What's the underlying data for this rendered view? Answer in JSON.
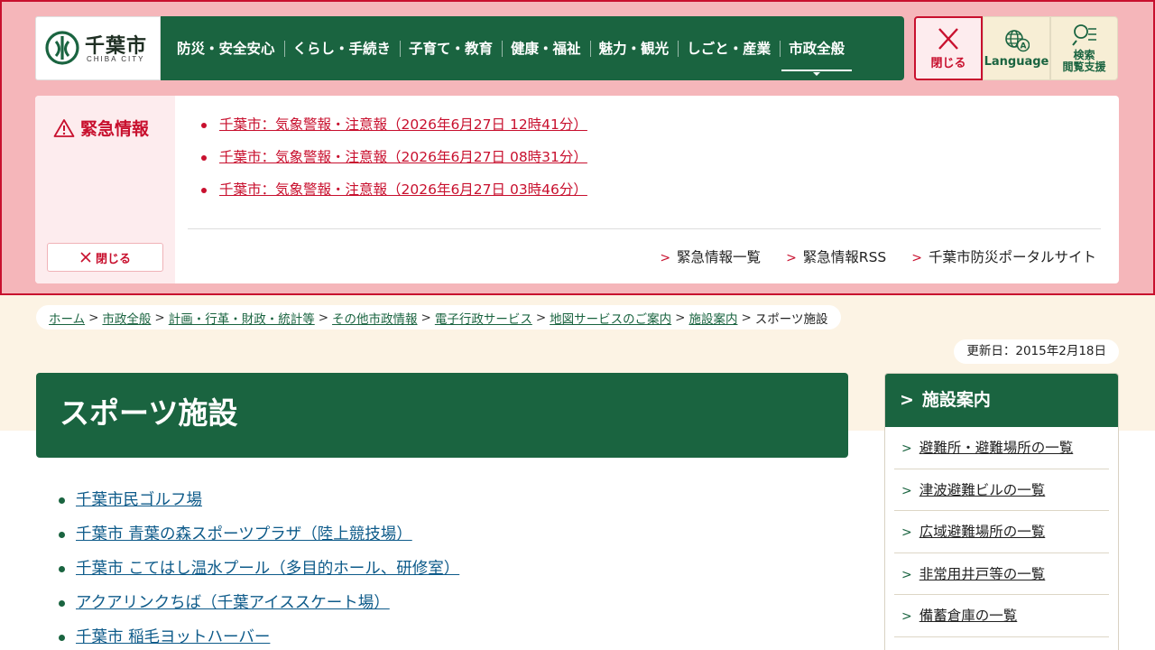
{
  "logo": {
    "ja": "千葉市",
    "en": "CHIBA CITY"
  },
  "global_nav": [
    {
      "label": "防災・安全安心"
    },
    {
      "label": "くらし・手続き"
    },
    {
      "label": "子育て・教育"
    },
    {
      "label": "健康・福祉"
    },
    {
      "label": "魅力・観光"
    },
    {
      "label": "しごと・産業"
    },
    {
      "label": "市政全般",
      "active": true
    }
  ],
  "tools": {
    "close_label": "閉じる",
    "language_label": "Language",
    "search_label_1": "検索",
    "search_label_2": "閲覧支援"
  },
  "alert": {
    "title": "緊急情報",
    "close_label": "閉じる",
    "items": [
      "千葉市：気象警報・注意報（2026年6月27日 12時41分）",
      "千葉市：気象警報・注意報（2026年6月27日 08時31分）",
      "千葉市：気象警報・注意報（2026年6月27日 03時46分）"
    ],
    "links": [
      "緊急情報一覧",
      "緊急情報RSS",
      "千葉市防災ポータルサイト"
    ]
  },
  "breadcrumb": {
    "items": [
      "ホーム",
      "市政全般",
      "計画・行革・財政・統計等",
      "その他市政情報",
      "電子行政サービス",
      "地図サービスのご案内",
      "施設案内"
    ],
    "current": "スポーツ施設"
  },
  "updated": "更新日：2015年2月18日",
  "page_title": "スポーツ施設",
  "content_links": [
    "千葉市民ゴルフ場",
    "千葉市 青葉の森スポーツプラザ（陸上競技場）",
    "千葉市 こてはし温水プール（多目的ホール、研修室）",
    "アクアリンクちば（千葉アイススケート場）",
    "千葉市 稲毛ヨットハーバー"
  ],
  "side_nav": {
    "title": "施設案内",
    "items": [
      "避難所・避難場所の一覧",
      "津波避難ビルの一覧",
      "広域避難場所の一覧",
      "非常用井戸等の一覧",
      "備蓄倉庫の一覧"
    ]
  },
  "colors": {
    "brand_green": "#1a6440",
    "alert_red": "#c8102e",
    "alert_bg": "#f5b6ba",
    "beige": "#fcf3e4"
  }
}
